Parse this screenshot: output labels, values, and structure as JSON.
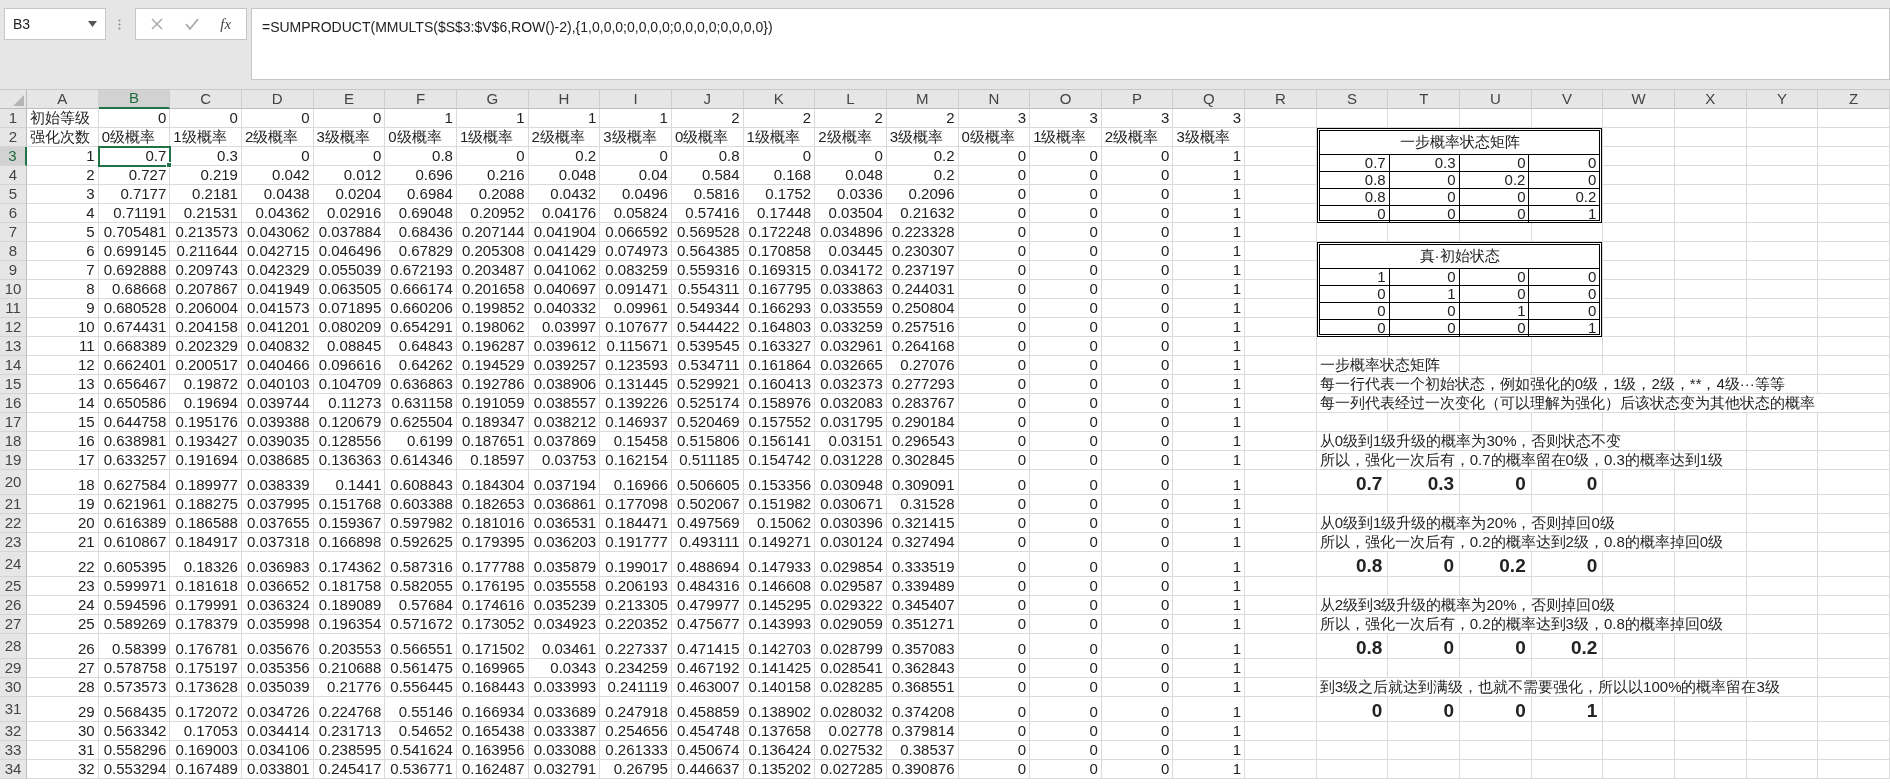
{
  "name_box": "B3",
  "fx_label": "fx",
  "formula": "=SUMPRODUCT(MMULTS($S$3:$V$6,ROW()-2),{1,0,0,0;0,0,0,0;0,0,0,0;0,0,0,0})",
  "columns": [
    {
      "label": "A",
      "selected": false
    },
    {
      "label": "B",
      "selected": true
    },
    {
      "label": "C",
      "selected": false
    },
    {
      "label": "D",
      "selected": false
    },
    {
      "label": "E",
      "selected": false
    },
    {
      "label": "F",
      "selected": false
    },
    {
      "label": "G",
      "selected": false
    },
    {
      "label": "H",
      "selected": false
    },
    {
      "label": "I",
      "selected": false
    },
    {
      "label": "J",
      "selected": false
    },
    {
      "label": "K",
      "selected": false
    },
    {
      "label": "L",
      "selected": false
    },
    {
      "label": "M",
      "selected": false
    },
    {
      "label": "N",
      "selected": false
    },
    {
      "label": "O",
      "selected": false
    },
    {
      "label": "P",
      "selected": false
    },
    {
      "label": "Q",
      "selected": false
    },
    {
      "label": "R",
      "selected": false
    },
    {
      "label": "S",
      "selected": false
    },
    {
      "label": "T",
      "selected": false
    },
    {
      "label": "U",
      "selected": false
    },
    {
      "label": "V",
      "selected": false
    },
    {
      "label": "W",
      "selected": false
    },
    {
      "label": "X",
      "selected": false
    },
    {
      "label": "Y",
      "selected": false
    },
    {
      "label": "Z",
      "selected": false
    }
  ],
  "rows": [
    {
      "number": "1",
      "selected": false,
      "cells": [
        "初始等级",
        "0",
        "0",
        "0",
        "0",
        "1",
        "1",
        "1",
        "1",
        "2",
        "2",
        "2",
        "2",
        "3",
        "3",
        "3",
        "3"
      ]
    },
    {
      "number": "2",
      "selected": false,
      "cells": [
        "强化次数",
        "0级概率",
        "1级概率",
        "2级概率",
        "3级概率",
        "0级概率",
        "1级概率",
        "2级概率",
        "3级概率",
        "0级概率",
        "1级概率",
        "2级概率",
        "3级概率",
        "0级概率",
        "1级概率",
        "2级概率",
        "3级概率"
      ]
    },
    {
      "number": "3",
      "selected": true,
      "cells": [
        "1",
        "0.7",
        "0.3",
        "0",
        "0",
        "0.8",
        "0",
        "0.2",
        "0",
        "0.8",
        "0",
        "0",
        "0.2",
        "0",
        "0",
        "0",
        "1"
      ]
    },
    {
      "number": "4",
      "selected": false,
      "cells": [
        "2",
        "0.727",
        "0.219",
        "0.042",
        "0.012",
        "0.696",
        "0.216",
        "0.048",
        "0.04",
        "0.584",
        "0.168",
        "0.048",
        "0.2",
        "0",
        "0",
        "0",
        "1"
      ]
    },
    {
      "number": "5",
      "selected": false,
      "cells": [
        "3",
        "0.7177",
        "0.2181",
        "0.0438",
        "0.0204",
        "0.6984",
        "0.2088",
        "0.0432",
        "0.0496",
        "0.5816",
        "0.1752",
        "0.0336",
        "0.2096",
        "0",
        "0",
        "0",
        "1"
      ]
    },
    {
      "number": "6",
      "selected": false,
      "cells": [
        "4",
        "0.71191",
        "0.21531",
        "0.04362",
        "0.02916",
        "0.69048",
        "0.20952",
        "0.04176",
        "0.05824",
        "0.57416",
        "0.17448",
        "0.03504",
        "0.21632",
        "0",
        "0",
        "0",
        "1"
      ]
    },
    {
      "number": "7",
      "selected": false,
      "cells": [
        "5",
        "0.705481",
        "0.213573",
        "0.043062",
        "0.037884",
        "0.68436",
        "0.207144",
        "0.041904",
        "0.066592",
        "0.569528",
        "0.172248",
        "0.034896",
        "0.223328",
        "0",
        "0",
        "0",
        "1"
      ]
    },
    {
      "number": "8",
      "selected": false,
      "cells": [
        "6",
        "0.699145",
        "0.211644",
        "0.042715",
        "0.046496",
        "0.67829",
        "0.205308",
        "0.041429",
        "0.074973",
        "0.564385",
        "0.170858",
        "0.03445",
        "0.230307",
        "0",
        "0",
        "0",
        "1"
      ]
    },
    {
      "number": "9",
      "selected": false,
      "cells": [
        "7",
        "0.692888",
        "0.209743",
        "0.042329",
        "0.055039",
        "0.672193",
        "0.203487",
        "0.041062",
        "0.083259",
        "0.559316",
        "0.169315",
        "0.034172",
        "0.237197",
        "0",
        "0",
        "0",
        "1"
      ]
    },
    {
      "number": "10",
      "selected": false,
      "cells": [
        "8",
        "0.68668",
        "0.207867",
        "0.041949",
        "0.063505",
        "0.666174",
        "0.201658",
        "0.040697",
        "0.091471",
        "0.554311",
        "0.167795",
        "0.033863",
        "0.244031",
        "0",
        "0",
        "0",
        "1"
      ]
    },
    {
      "number": "11",
      "selected": false,
      "cells": [
        "9",
        "0.680528",
        "0.206004",
        "0.041573",
        "0.071895",
        "0.660206",
        "0.199852",
        "0.040332",
        "0.09961",
        "0.549344",
        "0.166293",
        "0.033559",
        "0.250804",
        "0",
        "0",
        "0",
        "1"
      ]
    },
    {
      "number": "12",
      "selected": false,
      "cells": [
        "10",
        "0.674431",
        "0.204158",
        "0.041201",
        "0.080209",
        "0.654291",
        "0.198062",
        "0.03997",
        "0.107677",
        "0.544422",
        "0.164803",
        "0.033259",
        "0.257516",
        "0",
        "0",
        "0",
        "1"
      ]
    },
    {
      "number": "13",
      "selected": false,
      "cells": [
        "11",
        "0.668389",
        "0.202329",
        "0.040832",
        "0.08845",
        "0.64843",
        "0.196287",
        "0.039612",
        "0.115671",
        "0.539545",
        "0.163327",
        "0.032961",
        "0.264168",
        "0",
        "0",
        "0",
        "1"
      ]
    },
    {
      "number": "14",
      "selected": false,
      "cells": [
        "12",
        "0.662401",
        "0.200517",
        "0.040466",
        "0.096616",
        "0.64262",
        "0.194529",
        "0.039257",
        "0.123593",
        "0.534711",
        "0.161864",
        "0.032665",
        "0.27076",
        "0",
        "0",
        "0",
        "1"
      ]
    },
    {
      "number": "15",
      "selected": false,
      "cells": [
        "13",
        "0.656467",
        "0.19872",
        "0.040103",
        "0.104709",
        "0.636863",
        "0.192786",
        "0.038906",
        "0.131445",
        "0.529921",
        "0.160413",
        "0.032373",
        "0.277293",
        "0",
        "0",
        "0",
        "1"
      ]
    },
    {
      "number": "16",
      "selected": false,
      "cells": [
        "14",
        "0.650586",
        "0.19694",
        "0.039744",
        "0.11273",
        "0.631158",
        "0.191059",
        "0.038557",
        "0.139226",
        "0.525174",
        "0.158976",
        "0.032083",
        "0.283767",
        "0",
        "0",
        "0",
        "1"
      ]
    },
    {
      "number": "17",
      "selected": false,
      "cells": [
        "15",
        "0.644758",
        "0.195176",
        "0.039388",
        "0.120679",
        "0.625504",
        "0.189347",
        "0.038212",
        "0.146937",
        "0.520469",
        "0.157552",
        "0.031795",
        "0.290184",
        "0",
        "0",
        "0",
        "1"
      ]
    },
    {
      "number": "18",
      "selected": false,
      "cells": [
        "16",
        "0.638981",
        "0.193427",
        "0.039035",
        "0.128556",
        "0.6199",
        "0.187651",
        "0.037869",
        "0.15458",
        "0.515806",
        "0.156141",
        "0.03151",
        "0.296543",
        "0",
        "0",
        "0",
        "1"
      ]
    },
    {
      "number": "19",
      "selected": false,
      "cells": [
        "17",
        "0.633257",
        "0.191694",
        "0.038685",
        "0.136363",
        "0.614346",
        "0.18597",
        "0.03753",
        "0.162154",
        "0.511185",
        "0.154742",
        "0.031228",
        "0.302845",
        "0",
        "0",
        "0",
        "1"
      ]
    },
    {
      "number": "20",
      "selected": false,
      "cells": [
        "18",
        "0.627584",
        "0.189977",
        "0.038339",
        "0.1441",
        "0.608843",
        "0.184304",
        "0.037194",
        "0.16966",
        "0.506605",
        "0.153356",
        "0.030948",
        "0.309091",
        "0",
        "0",
        "0",
        "1"
      ]
    },
    {
      "number": "21",
      "selected": false,
      "cells": [
        "19",
        "0.621961",
        "0.188275",
        "0.037995",
        "0.151768",
        "0.603388",
        "0.182653",
        "0.036861",
        "0.177098",
        "0.502067",
        "0.151982",
        "0.030671",
        "0.31528",
        "0",
        "0",
        "0",
        "1"
      ]
    },
    {
      "number": "22",
      "selected": false,
      "cells": [
        "20",
        "0.616389",
        "0.186588",
        "0.037655",
        "0.159367",
        "0.597982",
        "0.181016",
        "0.036531",
        "0.184471",
        "0.497569",
        "0.15062",
        "0.030396",
        "0.321415",
        "0",
        "0",
        "0",
        "1"
      ]
    },
    {
      "number": "23",
      "selected": false,
      "cells": [
        "21",
        "0.610867",
        "0.184917",
        "0.037318",
        "0.166898",
        "0.592625",
        "0.179395",
        "0.036203",
        "0.191777",
        "0.493111",
        "0.149271",
        "0.030124",
        "0.327494",
        "0",
        "0",
        "0",
        "1"
      ]
    },
    {
      "number": "24",
      "selected": false,
      "cells": [
        "22",
        "0.605395",
        "0.18326",
        "0.036983",
        "0.174362",
        "0.587316",
        "0.177788",
        "0.035879",
        "0.199017",
        "0.488694",
        "0.147933",
        "0.029854",
        "0.333519",
        "0",
        "0",
        "0",
        "1"
      ]
    },
    {
      "number": "25",
      "selected": false,
      "cells": [
        "23",
        "0.599971",
        "0.181618",
        "0.036652",
        "0.181758",
        "0.582055",
        "0.176195",
        "0.035558",
        "0.206193",
        "0.484316",
        "0.146608",
        "0.029587",
        "0.339489",
        "0",
        "0",
        "0",
        "1"
      ]
    },
    {
      "number": "26",
      "selected": false,
      "cells": [
        "24",
        "0.594596",
        "0.179991",
        "0.036324",
        "0.189089",
        "0.57684",
        "0.174616",
        "0.035239",
        "0.213305",
        "0.479977",
        "0.145295",
        "0.029322",
        "0.345407",
        "0",
        "0",
        "0",
        "1"
      ]
    },
    {
      "number": "27",
      "selected": false,
      "cells": [
        "25",
        "0.589269",
        "0.178379",
        "0.035998",
        "0.196354",
        "0.571672",
        "0.173052",
        "0.034923",
        "0.220352",
        "0.475677",
        "0.143993",
        "0.029059",
        "0.351271",
        "0",
        "0",
        "0",
        "1"
      ]
    },
    {
      "number": "28",
      "selected": false,
      "cells": [
        "26",
        "0.58399",
        "0.176781",
        "0.035676",
        "0.203553",
        "0.566551",
        "0.171502",
        "0.03461",
        "0.227337",
        "0.471415",
        "0.142703",
        "0.028799",
        "0.357083",
        "0",
        "0",
        "0",
        "1"
      ]
    },
    {
      "number": "29",
      "selected": false,
      "cells": [
        "27",
        "0.578758",
        "0.175197",
        "0.035356",
        "0.210688",
        "0.561475",
        "0.169965",
        "0.0343",
        "0.234259",
        "0.467192",
        "0.141425",
        "0.028541",
        "0.362843",
        "0",
        "0",
        "0",
        "1"
      ]
    },
    {
      "number": "30",
      "selected": false,
      "cells": [
        "28",
        "0.573573",
        "0.173628",
        "0.035039",
        "0.21776",
        "0.556445",
        "0.168443",
        "0.033993",
        "0.241119",
        "0.463007",
        "0.140158",
        "0.028285",
        "0.368551",
        "0",
        "0",
        "0",
        "1"
      ]
    },
    {
      "number": "31",
      "selected": false,
      "cells": [
        "29",
        "0.568435",
        "0.172072",
        "0.034726",
        "0.224768",
        "0.55146",
        "0.166934",
        "0.033689",
        "0.247918",
        "0.458859",
        "0.138902",
        "0.028032",
        "0.374208",
        "0",
        "0",
        "0",
        "1"
      ]
    },
    {
      "number": "32",
      "selected": false,
      "cells": [
        "30",
        "0.563342",
        "0.17053",
        "0.034414",
        "0.231713",
        "0.54652",
        "0.165438",
        "0.033387",
        "0.254656",
        "0.454748",
        "0.137658",
        "0.02778",
        "0.379814",
        "0",
        "0",
        "0",
        "1"
      ]
    },
    {
      "number": "33",
      "selected": false,
      "cells": [
        "31",
        "0.558296",
        "0.169003",
        "0.034106",
        "0.238595",
        "0.541624",
        "0.163956",
        "0.033088",
        "0.261333",
        "0.450674",
        "0.136424",
        "0.027532",
        "0.38537",
        "0",
        "0",
        "0",
        "1"
      ]
    },
    {
      "number": "34",
      "selected": false,
      "cells": [
        "32",
        "0.553294",
        "0.167489",
        "0.033801",
        "0.245417",
        "0.536771",
        "0.162487",
        "0.032791",
        "0.26795",
        "0.446637",
        "0.135202",
        "0.027285",
        "0.390876",
        "0",
        "0",
        "0",
        "1"
      ]
    }
  ],
  "matrix_tables": [
    {
      "title": "一步概率状态矩阵",
      "rows": [
        [
          "0.7",
          "0.3",
          "0",
          "0"
        ],
        [
          "0.8",
          "0",
          "0.2",
          "0"
        ],
        [
          "0.8",
          "0",
          "0",
          "0.2"
        ],
        [
          "0",
          "0",
          "0",
          "1"
        ]
      ]
    },
    {
      "title": "真·初始状态",
      "rows": [
        [
          "1",
          "0",
          "0",
          "0"
        ],
        [
          "0",
          "1",
          "0",
          "0"
        ],
        [
          "0",
          "0",
          "1",
          "0"
        ],
        [
          "0",
          "0",
          "0",
          "1"
        ]
      ]
    }
  ],
  "notes": [
    {
      "lines": [
        "一步概率状态矩阵",
        "每一行代表一个初始状态，例如强化的0级，1级，2级，**，4级···等等",
        "每一列代表经过一次变化（可以理解为强化）后该状态变为其他状态的概率"
      ]
    },
    {
      "lines": [
        "从0级到1级升级的概率为30%，否则状态不变",
        "所以，强化一次后有，0.7的概率留在0级，0.3的概率达到1级"
      ],
      "values": [
        "0.7",
        "0.3",
        "0",
        "0"
      ]
    },
    {
      "lines": [
        "从0级到1级升级的概率为20%，否则掉回0级",
        "所以，强化一次后有，0.2的概率达到2级，0.8的概率掉回0级"
      ],
      "values": [
        "0.8",
        "0",
        "0.2",
        "0"
      ]
    },
    {
      "lines": [
        "从2级到3级升级的概率为20%，否则掉回0级",
        "所以，强化一次后有，0.2的概率达到3级，0.8的概率掉回0级"
      ],
      "values": [
        "0.8",
        "0",
        "0",
        "0.2"
      ]
    },
    {
      "lines": [
        "到3级之后就达到满级，也就不需要强化，所以以100%的概率留在3级"
      ],
      "values": [
        "0",
        "0",
        "0",
        "1"
      ]
    }
  ]
}
